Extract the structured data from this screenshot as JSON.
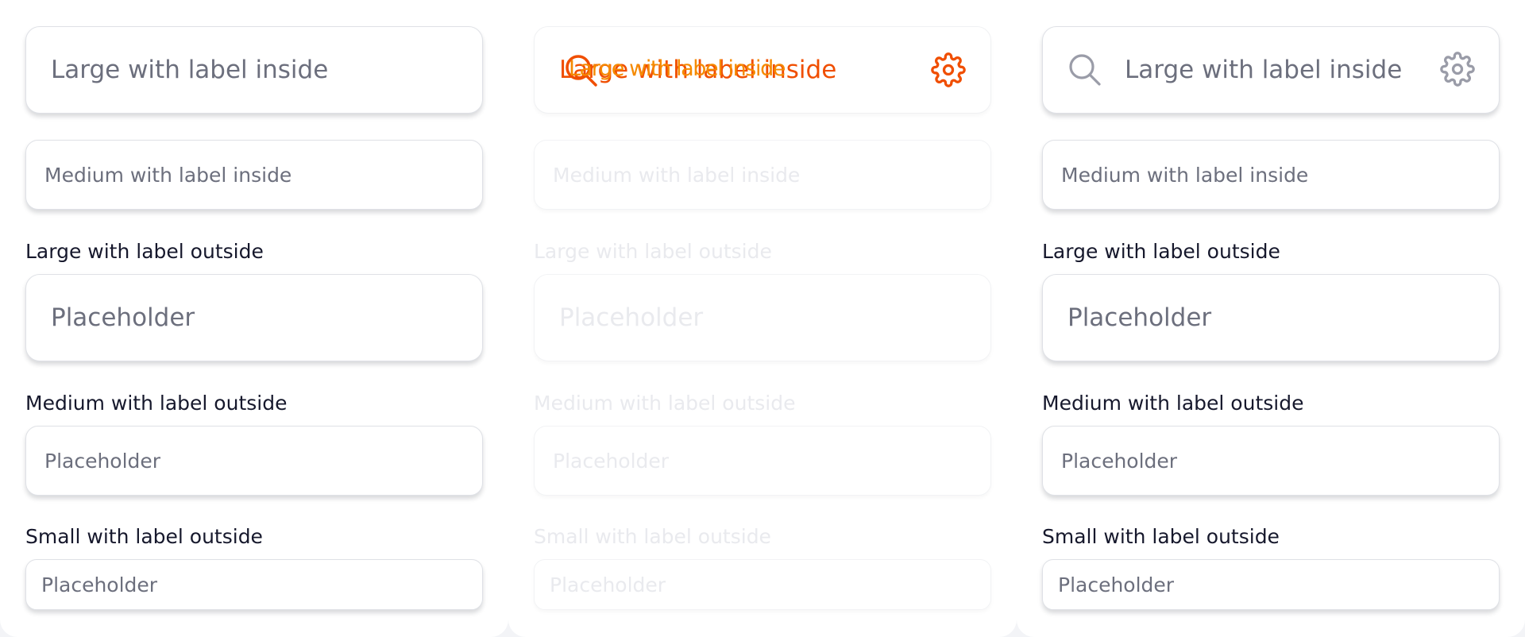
{
  "accent": "#f04e00",
  "overlay_accent": "#ffd000",
  "columns": [
    {
      "large_inside": "Large with label inside",
      "medium_inside": "Medium with label inside",
      "large_outside_label": "Large with label outside",
      "large_outside_placeholder": "Placeholder",
      "medium_outside_label": "Medium with label outside",
      "medium_outside_placeholder": "Placeholder",
      "small_outside_label": "Small with label outside",
      "small_outside_placeholder": "Placeholder"
    },
    {
      "large_inside": "Large with label inside",
      "large_inside_overlap": "Large with label inside",
      "medium_inside": "Medium with label inside",
      "large_outside_label": "Large with label outside",
      "large_outside_placeholder": "Placeholder",
      "medium_outside_label": "Medium with label outside",
      "medium_outside_placeholder": "Placeholder",
      "small_outside_label": "Small with label outside",
      "small_outside_placeholder": "Placeholder",
      "left_icon": "search-icon",
      "right_icon": "gear-icon"
    },
    {
      "large_inside": "Large with label inside",
      "medium_inside": "Medium with label inside",
      "large_outside_label": "Large with label outside",
      "large_outside_placeholder": "Placeholder",
      "medium_outside_label": "Medium with label outside",
      "medium_outside_placeholder": "Placeholder",
      "small_outside_label": "Small with label outside",
      "small_outside_placeholder": "Placeholder",
      "left_icon": "search-icon",
      "right_icon": "gear-icon"
    }
  ]
}
